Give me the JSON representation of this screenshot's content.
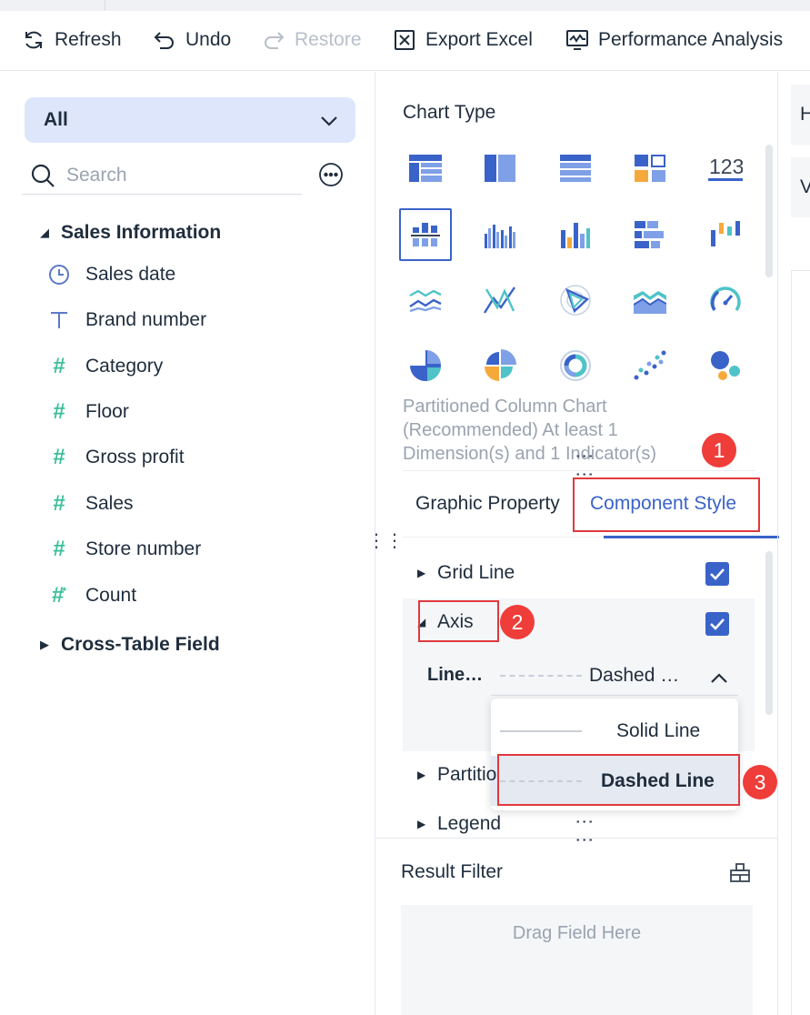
{
  "toolbar": {
    "refresh": "Refresh",
    "undo": "Undo",
    "restore": "Restore",
    "export_excel": "Export Excel",
    "performance_analysis": "Performance Analysis"
  },
  "left_panel": {
    "scope_dropdown": "All",
    "search_placeholder": "Search",
    "groups": [
      {
        "label": "Sales Information",
        "expanded": true,
        "fields": [
          {
            "label": "Sales date",
            "icon": "clock-icon"
          },
          {
            "label": "Brand number",
            "icon": "text-type-icon"
          },
          {
            "label": "Category",
            "icon": "hash-icon"
          },
          {
            "label": "Floor",
            "icon": "hash-icon"
          },
          {
            "label": "Gross profit",
            "icon": "hash-icon"
          },
          {
            "label": "Sales",
            "icon": "hash-icon"
          },
          {
            "label": "Store number",
            "icon": "hash-icon"
          },
          {
            "label": "Count",
            "icon": "hash-star-icon"
          }
        ]
      },
      {
        "label": "Cross-Table Field",
        "expanded": false
      }
    ]
  },
  "middle_panel": {
    "chart_type_label": "Chart Type",
    "chart_description": "Partitioned Column Chart (Recommended) At least 1 Dimension(s) and 1 Indicator(s)",
    "tabs": [
      "Graphic Property",
      "Component Style"
    ],
    "active_tab": "Component Style",
    "sections": [
      {
        "label": "Grid Line",
        "checked": true
      },
      {
        "label": "Axis",
        "checked": true,
        "expanded": true
      },
      {
        "label": "Partitio",
        "checked": false
      },
      {
        "label": "Legend",
        "checked": false
      }
    ],
    "line_type_label": "Line…",
    "line_type_value": "Dashed …",
    "line_options": [
      "Solid Line",
      "Dashed Line"
    ],
    "selected_option": "Dashed Line",
    "result_filter_label": "Result Filter",
    "drop_zone": "Drag Field Here"
  },
  "annotations": [
    "1",
    "2",
    "3"
  ],
  "right_panel": {
    "items": [
      "H",
      "V"
    ]
  },
  "colors": {
    "accent": "#3a63c9",
    "highlight": "#e0393e",
    "hash": "#3cbf9c"
  }
}
